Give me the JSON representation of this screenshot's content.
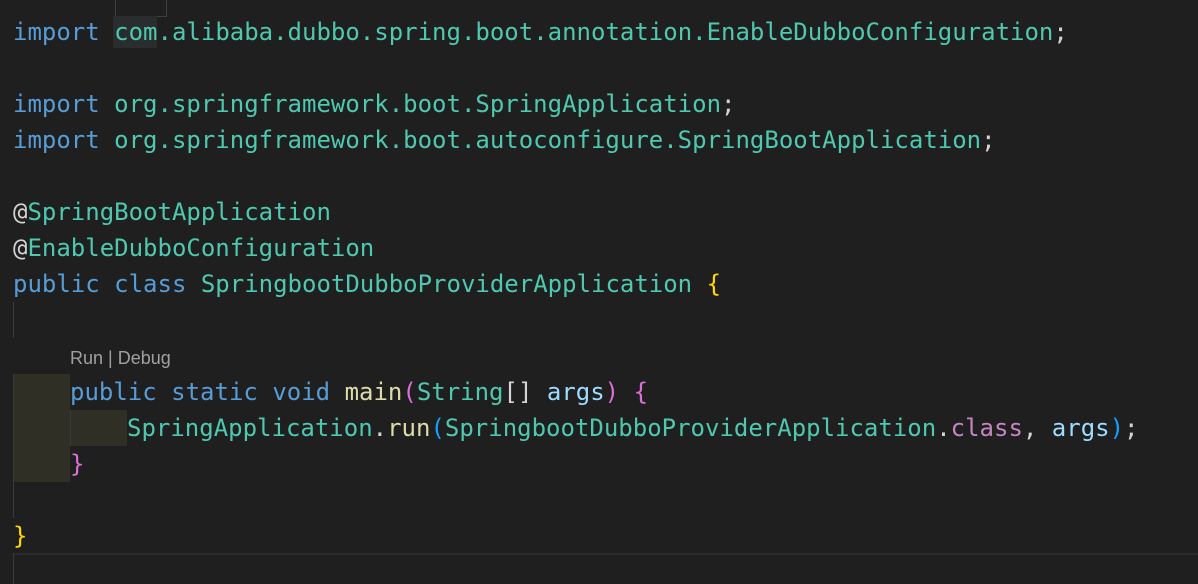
{
  "codelens": "Run | Debug",
  "lines": [
    {
      "import1_kw": "import",
      "import1_path": "com",
      "import1_dot1": ".",
      "import1_p2": "alibaba",
      "import1_dot2": ".",
      "import1_p3": "dubbo",
      "import1_dot3": ".",
      "import1_p4": "spring",
      "import1_dot4": ".",
      "import1_p5": "boot",
      "import1_dot5": ".",
      "import1_p6": "annotation",
      "import1_dot6": ".",
      "import1_cls": "EnableDubboConfiguration",
      "import1_semi": ";"
    }
  ],
  "code": {
    "l1": {
      "kw": "import",
      "a": "com",
      "b": ".alibaba.dubbo.spring.boot.annotation.EnableDubboConfiguration",
      "semi": ";"
    },
    "l3": {
      "kw": "import",
      "b": "org.springframework.boot.SpringApplication",
      "semi": ";"
    },
    "l4": {
      "kw": "import",
      "b": "org.springframework.boot.autoconfigure.SpringBootApplication",
      "semi": ";"
    },
    "l6": {
      "at": "@",
      "name": "SpringBootApplication"
    },
    "l7": {
      "at": "@",
      "name": "EnableDubboConfiguration"
    },
    "l8": {
      "kw1": "public",
      "kw2": "class",
      "name": "SpringbootDubboProviderApplication",
      "brace": "{"
    },
    "l10": {
      "kw1": "public",
      "kw2": "static",
      "kw3": "void",
      "fn": "main",
      "p1": "(",
      "type": "String",
      "arr": "[]",
      "param": "args",
      "p2": ")",
      "brace": "{"
    },
    "l11": {
      "obj": "SpringApplication",
      "dot": ".",
      "fn": "run",
      "p1": "(",
      "cls": "SpringbootDubboProviderApplication",
      "dot2": ".",
      "kw": "class",
      "comma": ",",
      "param": "args",
      "p2": ")",
      "semi": ";"
    },
    "l12": {
      "brace": "}"
    },
    "l14": {
      "brace": "}"
    }
  }
}
